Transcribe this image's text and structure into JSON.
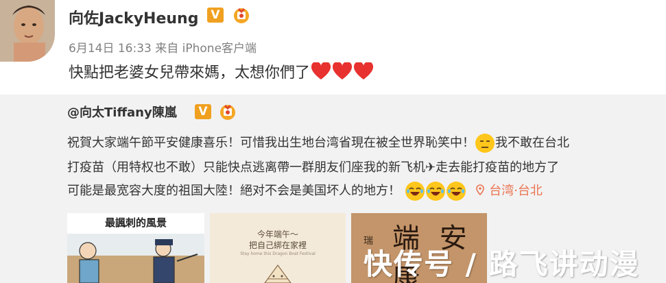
{
  "post": {
    "author": "向佐JackyHeung",
    "meta": "6月14日 16:33 来自 iPhone客户端",
    "text": "快點把老婆女兒帶來媽，太想你們了"
  },
  "repost": {
    "author": "@向太Tiffany陳嵐",
    "line1_a": "祝賀大家端午節平安健康喜乐！可惜我出生地台湾省現在被全世界恥笑中！",
    "line1_b": "我不敢在台北",
    "line2": "打疫苗（用特权也不敢）只能快点逃离帶一群朋友们座我的新飞机✈走去能打疫苗的地方了",
    "line3": "可能是最宽容大度的祖国大陸！絕对不会是美国坏人的地方！",
    "location": "台湾·台北",
    "images": [
      {
        "caption": "最諷刺的風景"
      },
      {
        "caption_1": "今年端午～",
        "caption_2": "把自己綁在家裡",
        "caption_small": "Stay home this Dragon Boat Festival"
      },
      {
        "caption": "端 安 康",
        "side": "瑞"
      }
    ]
  },
  "watermark": "快传号 / 路飞讲动漫",
  "colors": {
    "background": "#ffffff",
    "repost_bg": "#f2f2f2",
    "meta_text": "#808080",
    "badge_orange": "#f0a020",
    "heart_red": "#e8322f",
    "location": "#eb7350"
  }
}
